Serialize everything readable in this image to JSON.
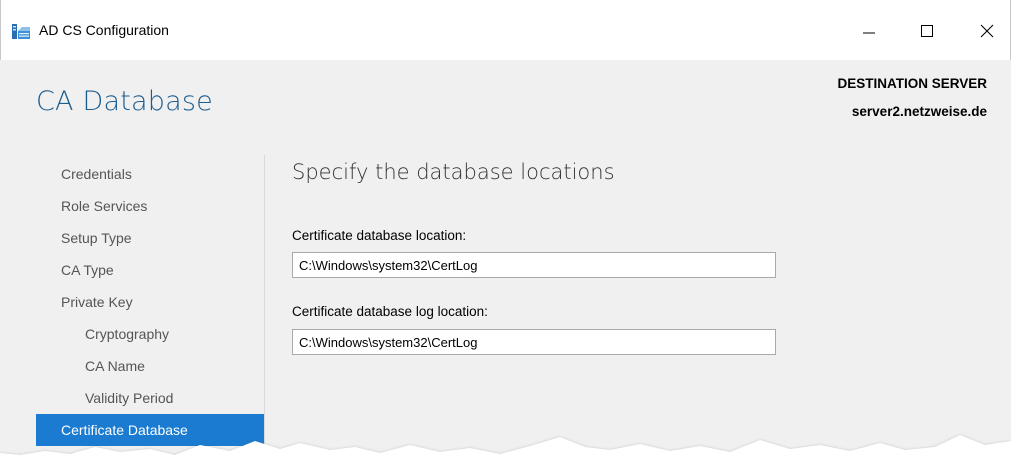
{
  "window": {
    "title": "AD CS Configuration",
    "controls": {
      "minimize": "minimize",
      "maximize": "maximize",
      "close": "close"
    }
  },
  "header": {
    "page_title": "CA Database",
    "destination_label": "DESTINATION SERVER",
    "destination_server": "server2.netzweise.de"
  },
  "sidebar": {
    "items": [
      {
        "label": "Credentials",
        "indent": 0,
        "active": false
      },
      {
        "label": "Role Services",
        "indent": 0,
        "active": false
      },
      {
        "label": "Setup Type",
        "indent": 0,
        "active": false
      },
      {
        "label": "CA Type",
        "indent": 0,
        "active": false
      },
      {
        "label": "Private Key",
        "indent": 0,
        "active": false
      },
      {
        "label": "Cryptography",
        "indent": 1,
        "active": false
      },
      {
        "label": "CA Name",
        "indent": 1,
        "active": false
      },
      {
        "label": "Validity Period",
        "indent": 1,
        "active": false
      },
      {
        "label": "Certificate Database",
        "indent": 0,
        "active": true
      }
    ]
  },
  "main": {
    "heading": "Specify the database locations",
    "db_location": {
      "label": "Certificate database location:",
      "value": "C:\\Windows\\system32\\CertLog"
    },
    "log_location": {
      "label": "Certificate database log location:",
      "value": "C:\\Windows\\system32\\CertLog"
    }
  },
  "colors": {
    "accent": "#1a7bd0",
    "title_blue": "#1c5d90",
    "background": "#f0f0f0"
  }
}
